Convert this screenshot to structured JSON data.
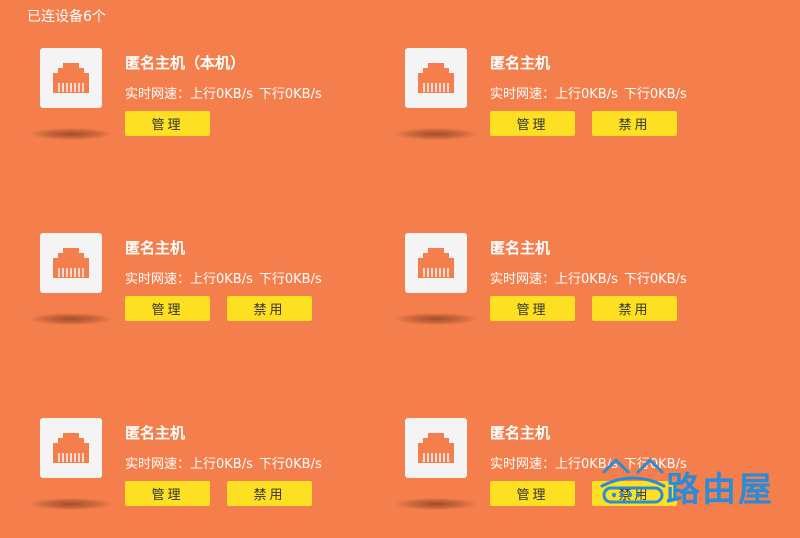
{
  "header": {
    "connected_count": "已连设备6个"
  },
  "colors": {
    "background": "#F47E4C",
    "button": "#FCE021",
    "icon_box": "#F4F4F4",
    "icon": "#F47E4C",
    "watermark": "#2A8BD8"
  },
  "devices": [
    {
      "name": "匿名主机（本机）",
      "speed_label": "实时网速：",
      "up": "上行0KB/s",
      "down": "下行0KB/s",
      "manage_label": "管理",
      "disable_label": ""
    },
    {
      "name": "匿名主机",
      "speed_label": "实时网速：",
      "up": "上行0KB/s",
      "down": "下行0KB/s",
      "manage_label": "管理",
      "disable_label": "禁用"
    },
    {
      "name": "匿名主机",
      "speed_label": "实时网速：",
      "up": "上行0KB/s",
      "down": "下行0KB/s",
      "manage_label": "管理",
      "disable_label": "禁用"
    },
    {
      "name": "匿名主机",
      "speed_label": "实时网速：",
      "up": "上行0KB/s",
      "down": "下行0KB/s",
      "manage_label": "管理",
      "disable_label": "禁用"
    },
    {
      "name": "匿名主机",
      "speed_label": "实时网速：",
      "up": "上行0KB/s",
      "down": "下行0KB/s",
      "manage_label": "管理",
      "disable_label": "禁用"
    },
    {
      "name": "匿名主机",
      "speed_label": "实时网速：",
      "up": "上行0KB/s",
      "down": "下行0KB/s",
      "manage_label": "管理",
      "disable_label": "禁用"
    }
  ],
  "watermark": {
    "text": "路由屋",
    "icon": "router-house-logo-icon"
  }
}
